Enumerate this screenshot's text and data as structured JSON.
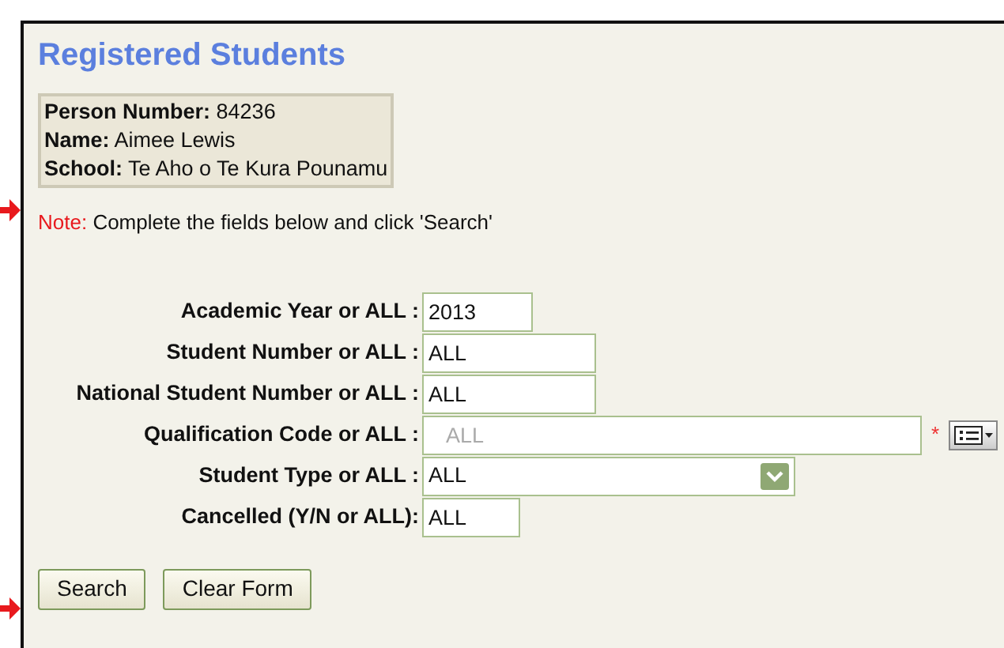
{
  "title": "Registered Students",
  "person": [
    {
      "label": "Person Number:",
      "value": "84236"
    },
    {
      "label": "Name:",
      "value": " Aimee Lewis"
    },
    {
      "label": "School:",
      "value": "Te Aho o Te Kura Pounamu"
    }
  ],
  "note": {
    "label": "Note:",
    "text": "Complete the fields below and click 'Search'"
  },
  "fields": [
    {
      "kind": "text",
      "label": "Academic Year or ALL :",
      "value": "2013"
    },
    {
      "kind": "text",
      "label": "Student Number or ALL :",
      "value": "ALL"
    },
    {
      "kind": "text",
      "label": "National Student Number or ALL :",
      "value": "ALL"
    },
    {
      "kind": "lookup",
      "label": "Qualification Code or ALL :",
      "placeholder": "ALL",
      "required_mark": "*"
    },
    {
      "kind": "select",
      "label": "Student Type or ALL :",
      "value": "ALL"
    },
    {
      "kind": "text",
      "label": "Cancelled (Y/N or ALL):",
      "value": "ALL"
    }
  ],
  "buttons": [
    "Search",
    "Clear Form"
  ]
}
